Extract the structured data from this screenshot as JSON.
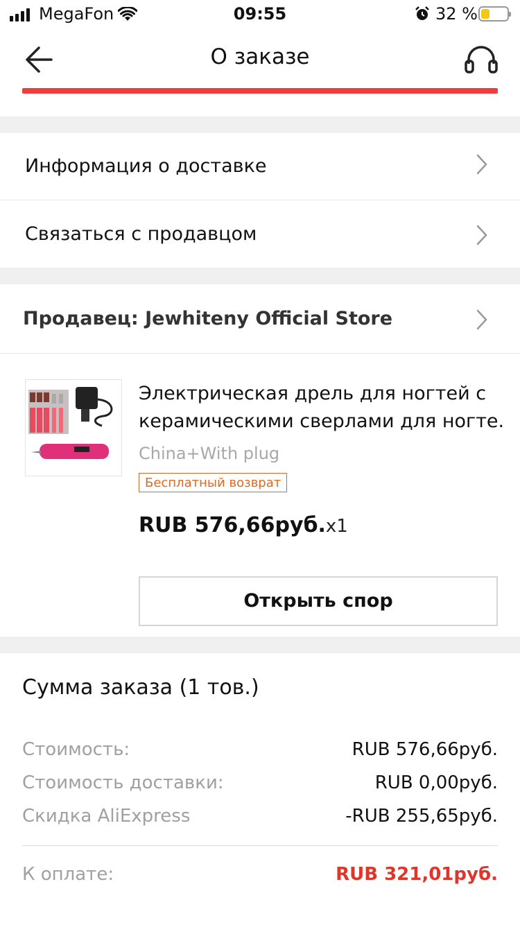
{
  "status_bar": {
    "carrier": "MegaFon",
    "time": "09:55",
    "battery_percent": "32 %",
    "battery_level": 0.32
  },
  "header": {
    "title": "О заказе",
    "accent_color": "#f23c3c"
  },
  "menu": {
    "delivery_info": "Информация о доставке",
    "contact_seller": "Связаться с продавцом"
  },
  "seller": {
    "label": "Продавец: Jewhiteny Official Store"
  },
  "product": {
    "title_line1": "Электрическая дрель для ногтей с",
    "title_line2": "керамическими сверлами для ногте...",
    "variant": "China+With plug",
    "badge": "Бесплатный возврат",
    "price": "RUB 576,66руб.",
    "quantity": "x1",
    "thumbnail_icon": "nail-drill-product-image"
  },
  "actions": {
    "open_dispute": "Открыть спор"
  },
  "summary": {
    "title": "Сумма заказа (1 тов.)",
    "rows": [
      {
        "label": "Стоимость:",
        "value": "RUB 576,66руб."
      },
      {
        "label": "Стоимость доставки:",
        "value": "RUB 0,00руб."
      },
      {
        "label": "Скидка AliExpress",
        "value": "-RUB 255,65руб."
      }
    ],
    "total_label": "К оплате:",
    "total_value": "RUB 321,01руб.",
    "total_color": "#e0352b"
  }
}
